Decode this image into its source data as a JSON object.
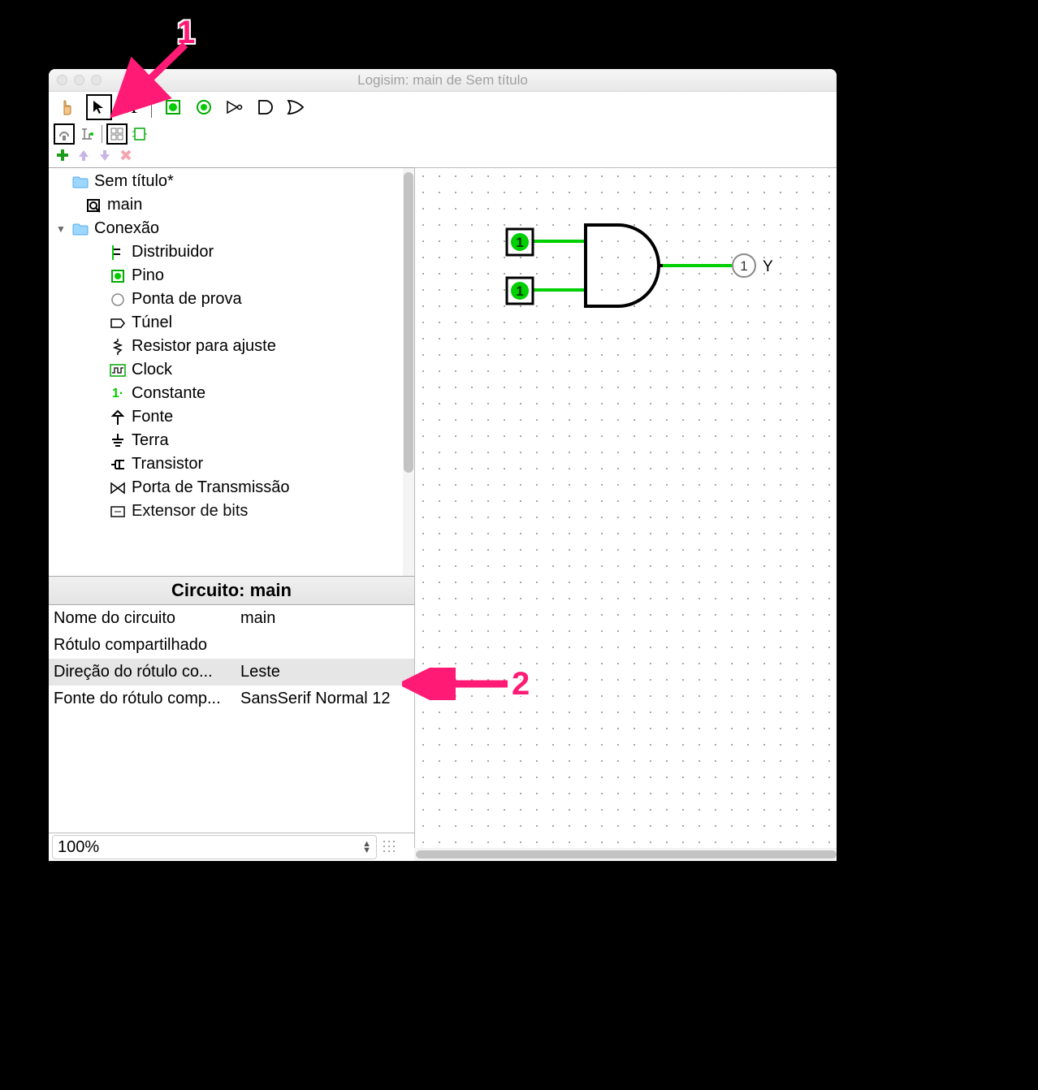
{
  "window": {
    "title": "Logisim: main de Sem título"
  },
  "toolbar": {
    "poke": "poke-tool",
    "select": "select-tool",
    "text": "A",
    "pin_in": "input-pin",
    "pin_out": "output-pin",
    "not": "not-gate",
    "and": "and-gate",
    "or": "or-gate"
  },
  "tree": {
    "root": "Sem título*",
    "main": "main",
    "conexao": "Conexão",
    "items": [
      "Distribuidor",
      "Pino",
      "Ponta de prova",
      "Túnel",
      "Resistor para ajuste",
      "Clock",
      "Constante",
      "Fonte",
      "Terra",
      "Transistor",
      "Porta de Transmissão",
      "Extensor de bits"
    ]
  },
  "props": {
    "header": "Circuito: main",
    "rows": [
      {
        "label": "Nome do circuito",
        "value": "main"
      },
      {
        "label": "Rótulo compartilhado",
        "value": ""
      },
      {
        "label": "Direção do rótulo co...",
        "value": "Leste"
      },
      {
        "label": "Fonte do rótulo comp...",
        "value": "SansSerif Normal 12"
      }
    ]
  },
  "zoom": "100%",
  "canvas": {
    "output_label": "Y",
    "input1": "1",
    "input2": "1",
    "output_val": "1"
  },
  "annotations": {
    "one": "1",
    "two": "2"
  }
}
